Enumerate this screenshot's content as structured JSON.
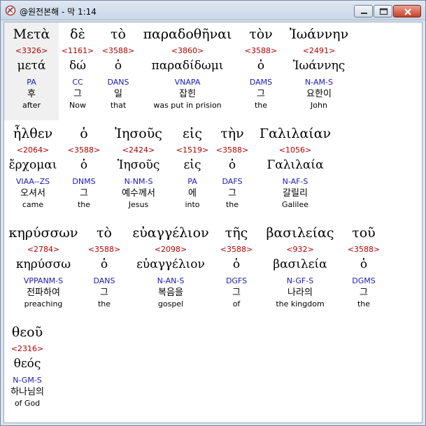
{
  "window": {
    "title": "@원전본해 - 막 1:14"
  },
  "words": [
    {
      "greek": "Μετὰ",
      "strong": "<3326>",
      "lemma": "μετά",
      "parse": "PA",
      "korean": "후",
      "english": "after"
    },
    {
      "greek": "δὲ",
      "strong": "<1161>",
      "lemma": "δώ",
      "parse": "CC",
      "korean": "그",
      "english": "Now"
    },
    {
      "greek": "τὸ",
      "strong": "<3588>",
      "lemma": "ὁ",
      "parse": "DANS",
      "korean": "일",
      "english": "that"
    },
    {
      "greek": "παραδοθῆναι",
      "strong": "<3860>",
      "lemma": "παραδίδωμι",
      "parse": "VNAPA",
      "korean": "잡힌",
      "english": "was put in prision"
    },
    {
      "greek": "τὸν",
      "strong": "<3588>",
      "lemma": "ὁ",
      "parse": "DAMS",
      "korean": "그",
      "english": "the"
    },
    {
      "greek": "Ἰωάννην",
      "strong": "<2491>",
      "lemma": "Ἰωάννης",
      "parse": "N-AM-S",
      "korean": "요한이",
      "english": "John"
    },
    {
      "greek": "ἦλθεν",
      "strong": "<2064>",
      "lemma": "ἔρχομαι",
      "parse": "VIAA--ZS",
      "korean": "오셔서",
      "english": "came"
    },
    {
      "greek": "ὁ",
      "strong": "<3588>",
      "lemma": "ὁ",
      "parse": "DNMS",
      "korean": "그",
      "english": "the"
    },
    {
      "greek": "Ἰησοῦς",
      "strong": "<2424>",
      "lemma": "Ἰησοῦς",
      "parse": "N-NM-S",
      "korean": "예수께서",
      "english": "Jesus"
    },
    {
      "greek": "εἰς",
      "strong": "<1519>",
      "lemma": "εἰς",
      "parse": "PA",
      "korean": "에",
      "english": "into"
    },
    {
      "greek": "τὴν",
      "strong": "<3588>",
      "lemma": "ὁ",
      "parse": "DAFS",
      "korean": "그",
      "english": "the"
    },
    {
      "greek": "Γαλιλαίαν",
      "strong": "<1056>",
      "lemma": "Γαλιλαία",
      "parse": "N-AF-S",
      "korean": "갈릴리",
      "english": "Galilee"
    },
    {
      "greek": "κηρύσσων",
      "strong": "<2784>",
      "lemma": "κηρύσσω",
      "parse": "VPPANM-S",
      "korean": "전파하여",
      "english": "preaching"
    },
    {
      "greek": "τὸ",
      "strong": "<3588>",
      "lemma": "ὁ",
      "parse": "DANS",
      "korean": "그",
      "english": "the"
    },
    {
      "greek": "εὐαγγέλιον",
      "strong": "<2098>",
      "lemma": "εὐαγγέλιον",
      "parse": "N-AN-S",
      "korean": "복음을",
      "english": "gospel"
    },
    {
      "greek": "τῆς",
      "strong": "<3588>",
      "lemma": "ὁ",
      "parse": "DGFS",
      "korean": "그",
      "english": "of"
    },
    {
      "greek": "βασιλείας",
      "strong": "<932>",
      "lemma": "βασιλεία",
      "parse": "N-GF-S",
      "korean": "나라의",
      "english": "the kingdom"
    },
    {
      "greek": "τοῦ",
      "strong": "<3588>",
      "lemma": "ὁ",
      "parse": "DGMS",
      "korean": "그",
      "english": "the"
    },
    {
      "greek": "θεοῦ",
      "strong": "<2316>",
      "lemma": "θεός",
      "parse": "N-GM-S",
      "korean": "하나님의",
      "english": "of God"
    }
  ]
}
